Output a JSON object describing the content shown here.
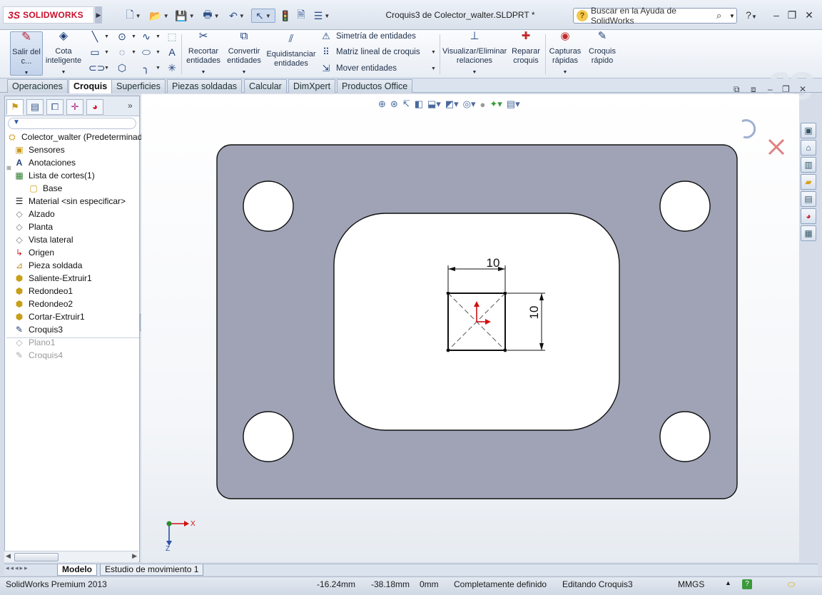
{
  "app": {
    "logo_prefix": "3S",
    "logo_text": "SOLIDWORKS",
    "document_title": "Croquis3 de Colector_walter.SLDPRT *",
    "help_search_placeholder": "Buscar en la Ayuda de SolidWorks"
  },
  "quick_access": [
    "new-icon",
    "open-icon",
    "save-icon",
    "print-icon",
    "undo-icon",
    "select-icon",
    "rebuild-icon",
    "options-icon",
    "customize-icon"
  ],
  "command_manager": {
    "exit_sketch": "Salir del c...",
    "smart_dimension": "Cota inteligente",
    "trim": "Recortar entidades",
    "convert": "Convertir entidades",
    "offset": "Equidistanciar entidades",
    "mirror": "Simetría de entidades",
    "linear_pattern": "Matriz lineal de croquis",
    "move": "Mover entidades",
    "relations": "Visualizar/Eliminar relaciones",
    "repair": "Reparar croquis",
    "quick_snaps": "Capturas rápidas",
    "rapid_sketch": "Croquis rápido"
  },
  "tabs": [
    "Operaciones",
    "Croquis",
    "Superficies",
    "Piezas soldadas",
    "Calcular",
    "DimXpert",
    "Productos Office"
  ],
  "active_tab": "Croquis",
  "feature_tree": {
    "root": "Colector_walter  (Predeterminado",
    "items": [
      {
        "label": "Sensores",
        "icon": "sensor-icon"
      },
      {
        "label": "Anotaciones",
        "icon": "annotation-icon"
      },
      {
        "label": "Lista de cortes(1)",
        "icon": "cutlist-icon"
      },
      {
        "label": "Base",
        "icon": "body-icon"
      },
      {
        "label": "Material <sin especificar>",
        "icon": "material-icon"
      },
      {
        "label": "Alzado",
        "icon": "plane-icon"
      },
      {
        "label": "Planta",
        "icon": "plane-icon"
      },
      {
        "label": "Vista lateral",
        "icon": "plane-icon"
      },
      {
        "label": "Origen",
        "icon": "origin-icon"
      },
      {
        "label": "Pieza soldada",
        "icon": "weldment-icon"
      },
      {
        "label": "Saliente-Extruir1",
        "icon": "extrude-icon"
      },
      {
        "label": "Redondeo1",
        "icon": "fillet-icon"
      },
      {
        "label": "Redondeo2",
        "icon": "fillet-icon"
      },
      {
        "label": "Cortar-Extruir1",
        "icon": "cut-icon"
      },
      {
        "label": "Croquis3",
        "icon": "sketch-icon"
      },
      {
        "label": "Plano1",
        "icon": "plane-icon"
      },
      {
        "label": "Croquis4",
        "icon": "sketch-icon"
      }
    ]
  },
  "sketch": {
    "dim_horizontal": "10",
    "dim_vertical": "10",
    "plate_color": "#9fa3b5",
    "axis_x": "X",
    "axis_z": "Z"
  },
  "bottom_tabs": [
    "Modelo",
    "Estudio de movimiento 1"
  ],
  "status": {
    "product": "SolidWorks Premium 2013",
    "x": "-16.24mm",
    "y": "-38.18mm",
    "z": "0mm",
    "state": "Completamente definido",
    "mode": "Editando Croquis3",
    "units": "MMGS"
  }
}
